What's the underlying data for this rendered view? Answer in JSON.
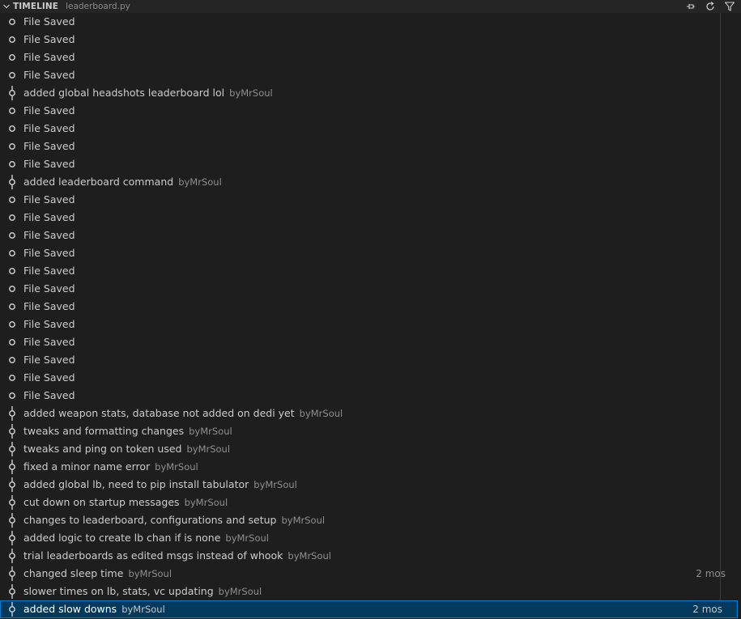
{
  "header": {
    "title": "TIMELINE",
    "file": "leaderboard.py"
  },
  "rows": [
    {
      "kind": "save",
      "label": "File Saved",
      "author": "",
      "time": ""
    },
    {
      "kind": "save",
      "label": "File Saved",
      "author": "",
      "time": ""
    },
    {
      "kind": "save",
      "label": "File Saved",
      "author": "",
      "time": ""
    },
    {
      "kind": "save",
      "label": "File Saved",
      "author": "",
      "time": ""
    },
    {
      "kind": "commit",
      "label": "added global headshots leaderboard lol",
      "author": "byMrSoul",
      "time": ""
    },
    {
      "kind": "save",
      "label": "File Saved",
      "author": "",
      "time": ""
    },
    {
      "kind": "save",
      "label": "File Saved",
      "author": "",
      "time": ""
    },
    {
      "kind": "save",
      "label": "File Saved",
      "author": "",
      "time": ""
    },
    {
      "kind": "save",
      "label": "File Saved",
      "author": "",
      "time": ""
    },
    {
      "kind": "commit",
      "label": "added leaderboard command",
      "author": "byMrSoul",
      "time": ""
    },
    {
      "kind": "save",
      "label": "File Saved",
      "author": "",
      "time": ""
    },
    {
      "kind": "save",
      "label": "File Saved",
      "author": "",
      "time": ""
    },
    {
      "kind": "save",
      "label": "File Saved",
      "author": "",
      "time": ""
    },
    {
      "kind": "save",
      "label": "File Saved",
      "author": "",
      "time": ""
    },
    {
      "kind": "save",
      "label": "File Saved",
      "author": "",
      "time": ""
    },
    {
      "kind": "save",
      "label": "File Saved",
      "author": "",
      "time": ""
    },
    {
      "kind": "save",
      "label": "File Saved",
      "author": "",
      "time": ""
    },
    {
      "kind": "save",
      "label": "File Saved",
      "author": "",
      "time": ""
    },
    {
      "kind": "save",
      "label": "File Saved",
      "author": "",
      "time": ""
    },
    {
      "kind": "save",
      "label": "File Saved",
      "author": "",
      "time": ""
    },
    {
      "kind": "save",
      "label": "File Saved",
      "author": "",
      "time": ""
    },
    {
      "kind": "save",
      "label": "File Saved",
      "author": "",
      "time": ""
    },
    {
      "kind": "commit",
      "label": "added weapon stats, database not added on dedi yet",
      "author": "byMrSoul",
      "time": ""
    },
    {
      "kind": "commit",
      "label": "tweaks and formatting changes",
      "author": "byMrSoul",
      "time": ""
    },
    {
      "kind": "commit",
      "label": "tweaks and ping on token used",
      "author": "byMrSoul",
      "time": ""
    },
    {
      "kind": "commit",
      "label": "fixed a minor name error",
      "author": "byMrSoul",
      "time": ""
    },
    {
      "kind": "commit",
      "label": "added global lb, need to pip install tabulator",
      "author": "byMrSoul",
      "time": ""
    },
    {
      "kind": "commit",
      "label": "cut down on startup messages",
      "author": "byMrSoul",
      "time": ""
    },
    {
      "kind": "commit",
      "label": "changes to leaderboard, configurations and setup",
      "author": "byMrSoul",
      "time": ""
    },
    {
      "kind": "commit",
      "label": "added logic to create lb chan if is none",
      "author": "byMrSoul",
      "time": ""
    },
    {
      "kind": "commit",
      "label": "trial leaderboards as edited msgs instead of whook",
      "author": "byMrSoul",
      "time": ""
    },
    {
      "kind": "commit",
      "label": "changed sleep time",
      "author": "byMrSoul",
      "time": "2 mos"
    },
    {
      "kind": "commit",
      "label": "slower times on lb, stats, vc updating",
      "author": "byMrSoul",
      "time": ""
    },
    {
      "kind": "commit",
      "label": "added slow downs",
      "author": "byMrSoul",
      "time": "2 mos",
      "selected": true
    }
  ],
  "colors": {
    "background": "#1e1e1e",
    "selection": "#04395e",
    "selection_border": "#007fd4"
  },
  "icons": {
    "collapse": "chevron-down-icon",
    "pin": "pin-icon",
    "refresh": "refresh-icon",
    "filter": "filter-icon",
    "save": "circle-icon",
    "commit": "git-commit-icon"
  }
}
